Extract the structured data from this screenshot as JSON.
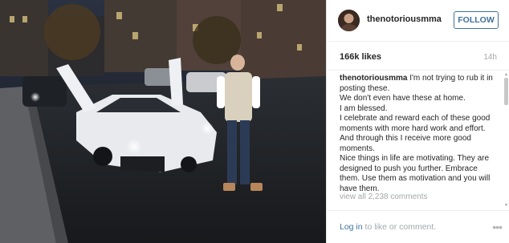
{
  "post": {
    "username": "thenotoriousmma",
    "follow_label": "FOLLOW",
    "likes": "166k likes",
    "time_ago": "14h",
    "caption_user": "thenotoriousmma",
    "caption_text": " I'm not trying to rub it in posting these.\nWe don't even have these at home.\nI am blessed.\nI celebrate and reward each of these good moments with more hard work and effort. And through this I receive more good moments.\nNice things in life are motivating. They are designed to push you further. Embrace them. Use them as motivation and you will have them.",
    "view_all_comments": "view all 2,238 comments"
  },
  "footer": {
    "login_text": "Log in",
    "login_suffix": " to like or comment.",
    "more_icon": "ellipsis-icon"
  },
  "colors": {
    "link_blue": "#3f729b",
    "muted_gray": "#a5a7aa",
    "text_dark": "#262626"
  }
}
